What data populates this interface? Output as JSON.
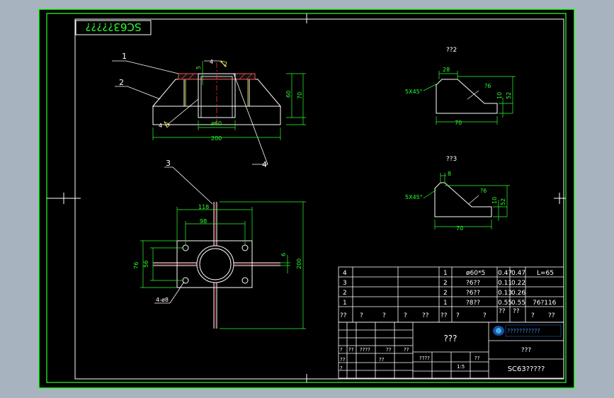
{
  "title_box": "SC63?????",
  "parts": [
    "1",
    "2",
    "3",
    "4"
  ],
  "main": {
    "weld_1": "4",
    "weld_2": "4",
    "dim_top": "5",
    "dim_h1": "60",
    "dim_h2": "70",
    "dim_dia": "ø60",
    "dim_width": "200"
  },
  "plan": {
    "dim_118": "118",
    "dim_98": "98",
    "dim_76": "76",
    "dim_56": "56",
    "dim_6": "6",
    "dim_200": "200",
    "hole_note": "4-ø8"
  },
  "part2": {
    "title": "??2",
    "dim_28": "28",
    "chamfer": "5X45°",
    "dim_r6": "?6",
    "dim_10": "10",
    "dim_52": "52",
    "dim_70": "70"
  },
  "part3": {
    "title": "??3",
    "dim_8": "8",
    "chamfer": "5X45°",
    "dim_r6": "?6",
    "dim_10": "10",
    "dim_52": "52",
    "dim_70": "70"
  },
  "bom_rows": [
    {
      "no": "4",
      "qty": "1",
      "spec": "ø60*5",
      "w1": "0.47",
      "w2": "0.47",
      "note": "L=65"
    },
    {
      "no": "3",
      "qty": "2",
      "spec": "?6??",
      "w1": "0.11",
      "w2": "0.22",
      "note": ""
    },
    {
      "no": "2",
      "qty": "2",
      "spec": "?6??",
      "w1": "0.13",
      "w2": "0.26",
      "note": ""
    },
    {
      "no": "1",
      "qty": "1",
      "spec": "?8??",
      "w1": "0.55",
      "w2": "0.55",
      "note": "76?116"
    }
  ],
  "bom_header": {
    "c1": "??",
    "c2": "?",
    "c3": "?",
    "c4": "?",
    "c5": "??",
    "c6": "??",
    "c7": "?",
    "c8": "?",
    "c9": "??",
    "c10": "??",
    "c11": "?",
    "c12": "??"
  },
  "title_block": {
    "name": "???",
    "drawing_no": "SC63?????",
    "company": "???????????",
    "cell_label": "???",
    "left_small": [
      "?",
      "??",
      "????",
      "??",
      "??",
      "??",
      "??",
      "?",
      "????",
      "??",
      "1:5"
    ]
  }
}
